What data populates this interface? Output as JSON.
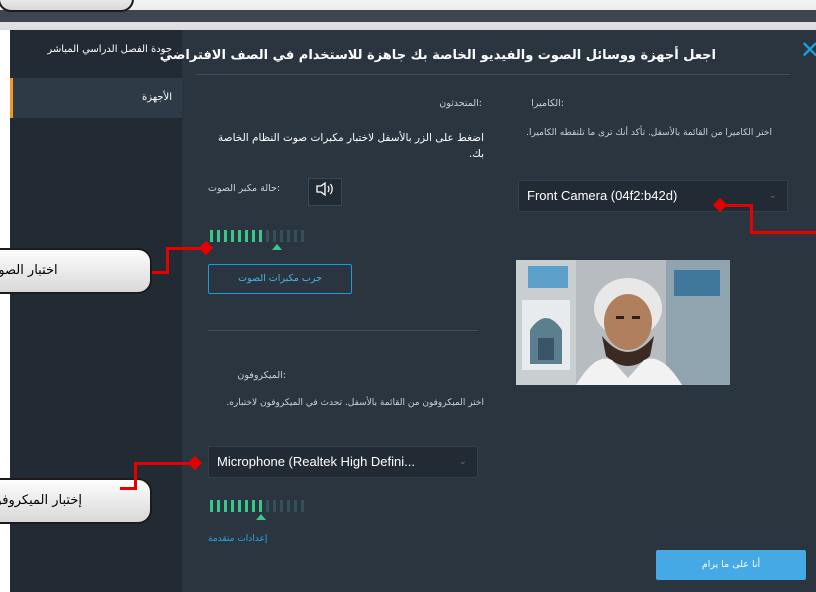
{
  "sidebar": {
    "items": [
      {
        "label": "جودة الفصل الدراسي المباشر"
      },
      {
        "label": "الأجهزة"
      }
    ]
  },
  "header": {
    "title": "اجعل أجهزة ووسائل الصوت والفيديو الخاصة بك جاهزة للاستخدام في الصف الافتراضي"
  },
  "speakers": {
    "label": ":المتحدثون",
    "description": "اضغط على الزر بالأسفل لاختبار مكبرات صوت النظام الخاصة بك.",
    "status_label": ":حالة مكبر الصوت",
    "test_button": "جرب مكبرات الصوت"
  },
  "camera": {
    "label": ":الكاميرا",
    "description": "اختر الكاميرا من القائمة بالأسفل. تأكد أنك ترى ما تلتقطه الكاميرا.",
    "selected": "Front Camera (04f2:b42d)"
  },
  "microphone": {
    "label": ":الميكروفون",
    "description": "اختر الميكروفون من القائمة بالأسفل. تحدث في الميكروفون لاختباره.",
    "selected": "Microphone (Realtek High Defini...",
    "advanced_link": "إعدادات متقدمة"
  },
  "footer": {
    "ready_button": "أنا على ما يرام"
  },
  "callouts": {
    "speaker_test": "اختبار الصوت",
    "mic_test": "إختبار الميكروفون"
  },
  "meters": {
    "speaker_level": 0.6,
    "mic_level": 0.6
  },
  "colors": {
    "accent": "#1ea0e0",
    "sidebar_active": "#f39a1a",
    "meter_on": "#38c88a",
    "callout_connector": "#e60000"
  }
}
